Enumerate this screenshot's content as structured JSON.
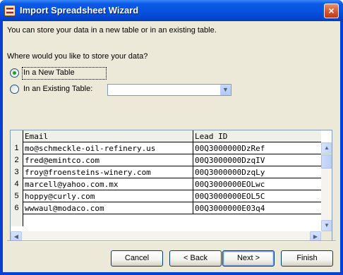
{
  "window": {
    "title": "Import Spreadsheet Wizard",
    "close_glyph": "×"
  },
  "intro_text": "You can store your data in a new table or in an existing table.",
  "question_text": "Where would you like to store your data?",
  "options": {
    "new_table_label": "In a New Table",
    "existing_table_label": "In an Existing Table:",
    "selected": "new_table"
  },
  "existing_table_combo": {
    "value": "",
    "dropdown_glyph": "▼"
  },
  "grid": {
    "columns": [
      "Email",
      "Lead ID"
    ],
    "rows": [
      {
        "num": "1",
        "email": "mo@schmeckle-oil-refinery.us",
        "lead_id": "00Q3000000DzRef"
      },
      {
        "num": "2",
        "email": "fred@emintco.com",
        "lead_id": "00Q3000000DzqIV"
      },
      {
        "num": "3",
        "email": "froy@froensteins-winery.com",
        "lead_id": "00Q3000000DzqLy"
      },
      {
        "num": "4",
        "email": "marcell@yahoo.com.mx",
        "lead_id": "00Q3000000EOLwc"
      },
      {
        "num": "5",
        "email": "hoppy@curly.com",
        "lead_id": "00Q3000000EOL5C"
      },
      {
        "num": "6",
        "email": "wwwaul@modaco.com",
        "lead_id": "00Q3000000E03q4"
      }
    ],
    "scroll_up_glyph": "▲",
    "scroll_down_glyph": "▼",
    "scroll_left_glyph": "◀",
    "scroll_right_glyph": "▶"
  },
  "buttons": {
    "cancel": "Cancel",
    "back": "< Back",
    "next": "Next >",
    "finish": "Finish"
  },
  "colors": {
    "title_bar": "#0754e0",
    "dialog_bg": "#ece9d8",
    "close_button": "#d6502a",
    "radio_selected": "#21a121"
  }
}
